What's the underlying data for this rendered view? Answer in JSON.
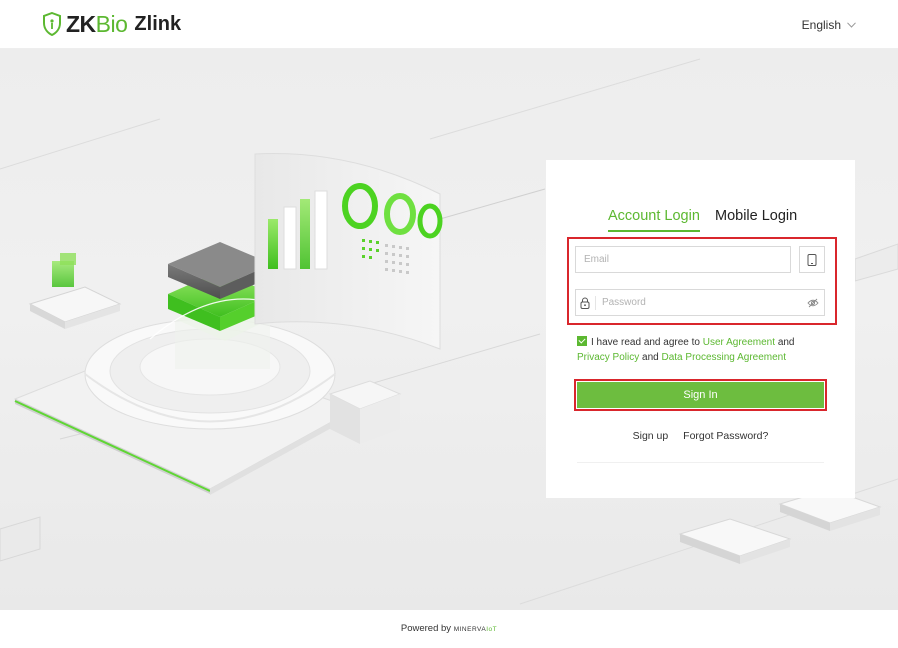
{
  "header": {
    "logo_zk": "ZK",
    "logo_bio": "Bio",
    "logo_product": "Zlink",
    "language": "English"
  },
  "login": {
    "tabs": [
      {
        "label": "Account Login",
        "active": true
      },
      {
        "label": "Mobile Login",
        "active": false
      }
    ],
    "email_placeholder": "Email",
    "password_placeholder": "Password",
    "agree": {
      "prefix": "I have read and agree to",
      "user_agreement": "User Agreement",
      "and1": "and",
      "privacy_policy": "Privacy Policy",
      "and2": "and",
      "data_processing": "Data Processing Agreement",
      "checked": true
    },
    "sign_in": "Sign In",
    "sign_up": "Sign up",
    "forgot_password": "Forgot Password?"
  },
  "footer": {
    "powered_by": "Powered by",
    "brand_main": "MINERVA",
    "brand_suffix": "IoT"
  },
  "colors": {
    "brand_green": "#5cb831",
    "button_green": "#6dbd3f",
    "highlight_red": "#d9262c"
  },
  "icons": {
    "logo": "shield-logo-icon",
    "language": "chevron-down-icon",
    "phone": "phone-icon",
    "lock": "lock-icon",
    "visibility": "eye-off-icon",
    "checkbox": "checkbox-checked-icon"
  }
}
